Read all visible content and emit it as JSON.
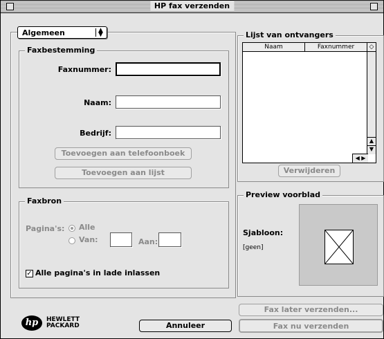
{
  "window": {
    "title": "HP fax verzenden"
  },
  "popup": {
    "selected": "Algemeen"
  },
  "destination": {
    "group_label": "Faxbestemming",
    "fax_label": "Faxnummer:",
    "name_label": "Naam:",
    "company_label": "Bedrijf:",
    "add_phonebook": "Toevoegen aan telefoonboek",
    "add_list": "Toevoegen aan lijst"
  },
  "source": {
    "group_label": "Faxbron",
    "pages_label": "Pagina's:",
    "all_label": "Alle",
    "from_label": "Van:",
    "to_label": "Aan:",
    "tray_checkbox": "Alle pagina's in lade inlassen"
  },
  "recipients": {
    "group_label": "Lijst van ontvangers",
    "col_name": "Naam",
    "col_fax": "Faxnummer",
    "remove_button": "Verwijderen"
  },
  "preview": {
    "group_label": "Preview voorblad",
    "template_label": "Sjabloon:",
    "template_value": "[geen]"
  },
  "actions": {
    "send_later": "Fax later verzenden...",
    "cancel": "Annuleer",
    "send_now": "Fax nu verzenden"
  },
  "logo": {
    "line1": "HEWLETT",
    "line2": "PACKARD",
    "mark": "hp"
  }
}
